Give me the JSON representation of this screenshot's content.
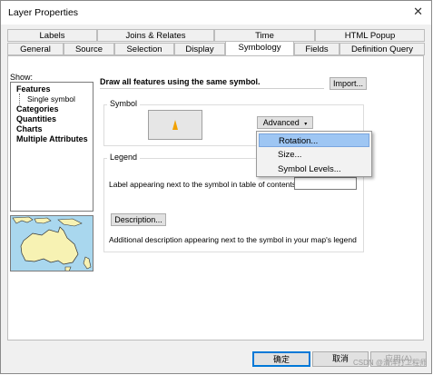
{
  "window": {
    "title": "Layer Properties",
    "close": "✕"
  },
  "tabs_top": [
    "Labels",
    "Joins & Relates",
    "Time",
    "HTML Popup"
  ],
  "tabs_bottom": [
    "General",
    "Source",
    "Selection",
    "Display",
    "Symbology",
    "Fields",
    "Definition Query"
  ],
  "active_tab": "Symbology",
  "show": {
    "label": "Show:",
    "items": [
      "Features",
      "Categories",
      "Quantities",
      "Charts",
      "Multiple Attributes"
    ],
    "sub_item": "Single symbol"
  },
  "main": {
    "description": "Draw all features using the same symbol.",
    "import_label": "Import...",
    "symbol_group": "Symbol",
    "advanced_label": "Advanced",
    "legend_group": "Legend",
    "legend_label_text": "Label appearing next to the symbol in table of contents:",
    "legend_label_value": "",
    "description_button": "Description...",
    "legend_description_text": "Additional description appearing next to the symbol in your map's legend"
  },
  "advanced_menu": [
    "Rotation...",
    "Size...",
    "Symbol Levels..."
  ],
  "footer": {
    "ok": "确定",
    "cancel": "取消",
    "apply": "应用(A)"
  },
  "watermark": "CSDN @清洋打工程师",
  "colors": {
    "symbol": "#f2a100",
    "highlight": "#9ec6f3",
    "map_water": "#a9d7ee",
    "map_land": "#f7f2b3"
  }
}
